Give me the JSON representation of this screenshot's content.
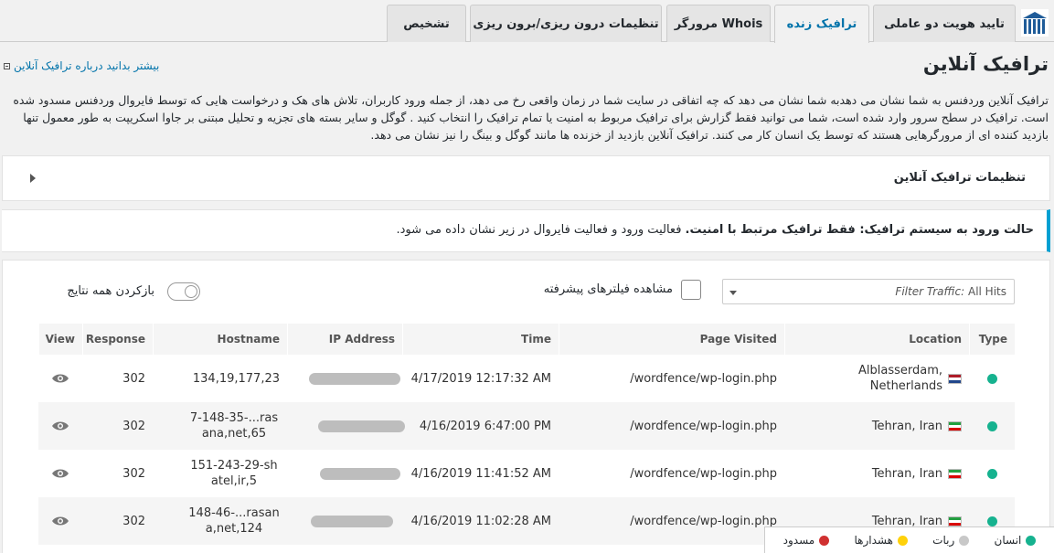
{
  "tabs": [
    {
      "label": "تایید هویت دو عاملی"
    },
    {
      "label": "ترافیک زنده",
      "active": true
    },
    {
      "label": "مرورگر Whois"
    },
    {
      "label": "تنظیمات درون ریزی/برون ریزی"
    },
    {
      "label": "تشخیص"
    }
  ],
  "learn_more": "بیشتر بدانید درباره ترافیک آنلاین",
  "page_title": "ترافیک آنلاین",
  "description": "ترافیک آنلاین وردفنس به شما نشان می دهدبه شما نشان می دهد که چه اتفاقی در سایت شما در زمان واقعی رخ می دهد، از جمله ورود کاربران، تلاش های هک و درخواست هایی که توسط فایروال وردفنس مسدود شده است. ترافیک در سطح سرور وارد شده است، شما می توانید فقط گزارش برای ترافیک مربوط به امنیت یا تمام ترافیک را انتخاب کنید . گوگل و سایر بسته های تجزیه و تحلیل مبتنی بر جاوا اسکریپت به طور معمول تنها بازدید کننده ای از مرورگرهایی هستند که توسط یک انسان کار می کنند. ترافیک آنلاین بازدید از خزنده ها مانند گوگل و بینگ را نیز نشان می دهد.",
  "settings_title": "تنظیمات ترافیک آنلاین",
  "notice": {
    "bold": "حالت ورود به سیستم ترافیک: فقط ترافیک مرتبط با امنیت.",
    "rest": " فعالیت ورود و فعالیت فایروال در زیر نشان داده می شود."
  },
  "filter": {
    "label": "Filter Traffic:",
    "value": "All Hits"
  },
  "advanced_filters_label": "مشاهده فیلترهای پیشرفته",
  "expand_all_label": "بازکردن همه نتایج",
  "columns": {
    "type": "Type",
    "location": "Location",
    "page": "Page Visited",
    "time": "Time",
    "ip": "IP Address",
    "hostname": "Hostname",
    "response": "Response",
    "view": "View"
  },
  "rows": [
    {
      "location": "Alblasserdam, Netherlands",
      "flag": "nl",
      "page": "/wordfence/wp-login.php",
      "time": "4/17/2019 12:17:32 AM",
      "hostname": "134,19,177,23",
      "response": "302"
    },
    {
      "location": "Tehran, Iran",
      "flag": "ir",
      "page": "/wordfence/wp-login.php",
      "time": "4/16/2019 6:47:00 PM",
      "hostname": "7-148-35-...rasana,net,65",
      "response": "302"
    },
    {
      "location": "Tehran, Iran",
      "flag": "ir",
      "page": "/wordfence/wp-login.php",
      "time": "4/16/2019 11:41:52 AM",
      "hostname": "151-243-29-shatel,ir,5",
      "response": "302"
    },
    {
      "location": "Tehran, Iran",
      "flag": "ir",
      "page": "/wordfence/wp-login.php",
      "time": "4/16/2019 11:02:28 AM",
      "hostname": "148-46-...rasana,net,124",
      "response": "302"
    }
  ],
  "legend": [
    {
      "label": "انسان",
      "color": "#16b28f"
    },
    {
      "label": "ربات",
      "color": "#c8c8c8"
    },
    {
      "label": "هشدارها",
      "color": "#ffd10a"
    },
    {
      "label": "مسدود",
      "color": "#d03030"
    }
  ]
}
